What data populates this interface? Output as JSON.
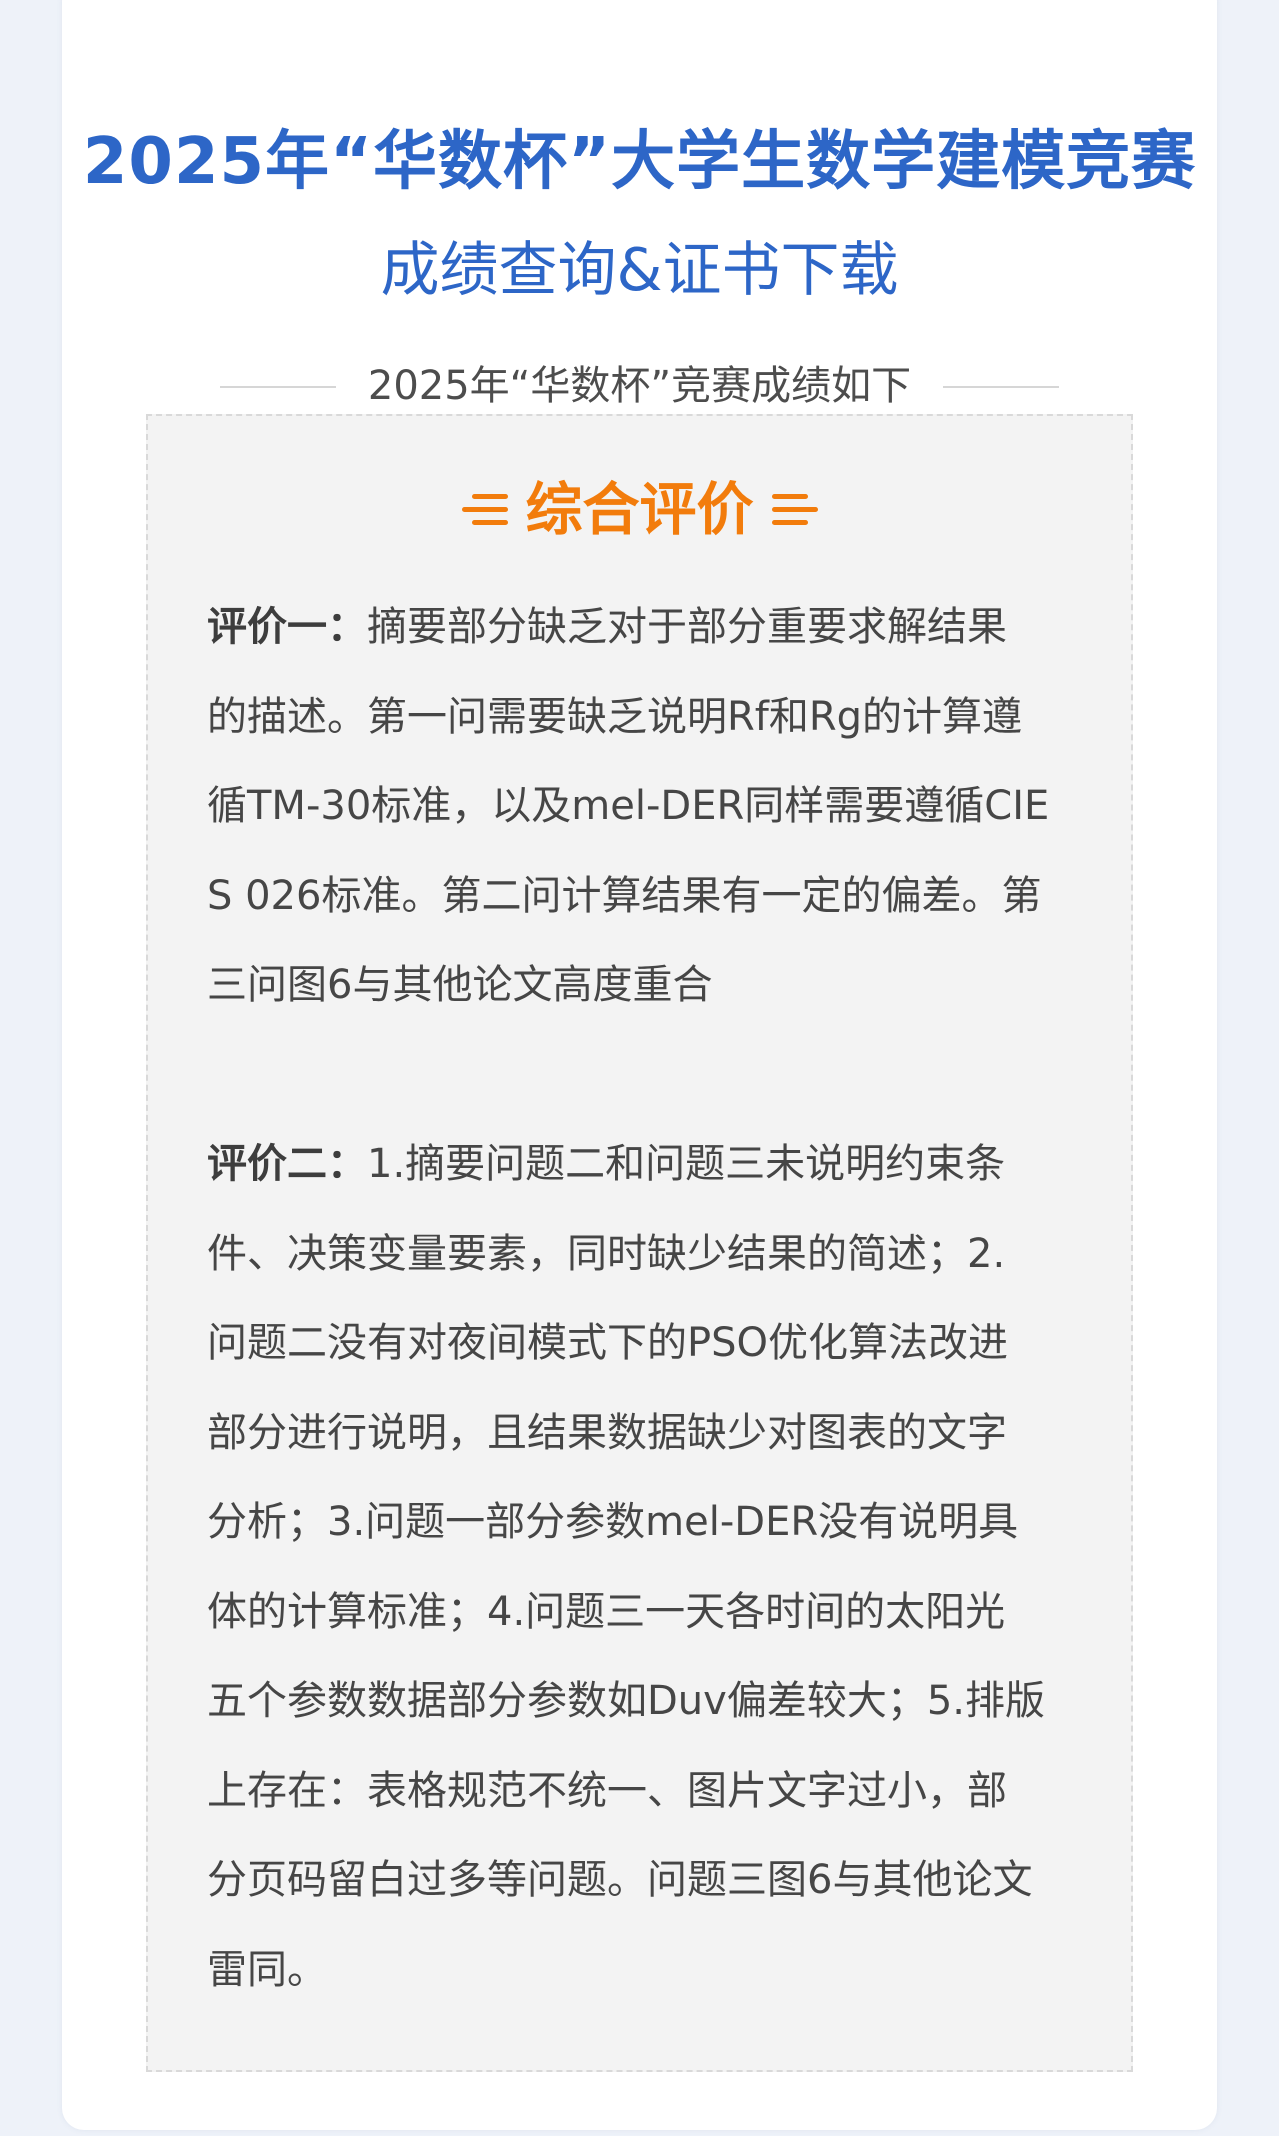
{
  "header": {
    "title": "2025年“华数杯”大学生数学建模竞赛",
    "subtitle": "成绩查询&证书下载",
    "section_caption": "2025年“华数杯”竞赛成绩如下"
  },
  "evaluation": {
    "heading": "综合评价",
    "accent_color": "#f27c0c",
    "title_color": "#2d66c7",
    "comments": [
      {
        "label": "评价一：",
        "lines": [
          "摘要部分缺乏对于部分重要求解结果",
          "的描述。第一问需要缺乏说明Rf和Rg的计算遵",
          "循TM-30标准，以及mel-DER同样需要遵循CIE",
          "S 026标准。第二问计算结果有一定的偏差。第",
          "三问图6与其他论文高度重合"
        ]
      },
      {
        "label": "评价二：",
        "lines": [
          "1.摘要问题二和问题三未说明约束条",
          "件、决策变量要素，同时缺少结果的简述；2.",
          "问题二没有对夜间模式下的PSO优化算法改进",
          "部分进行说明，且结果数据缺少对图表的文字",
          "分析；3.问题一部分参数mel-DER没有说明具",
          "体的计算标准；4.问题三一天各时间的太阳光",
          "五个参数数据部分参数如Duv偏差较大；5.排版",
          "上存在：表格规范不统一、图片文字过小，部",
          "分页码留白过多等问题。问题三图6与其他论文",
          "雷同。"
        ]
      }
    ]
  }
}
